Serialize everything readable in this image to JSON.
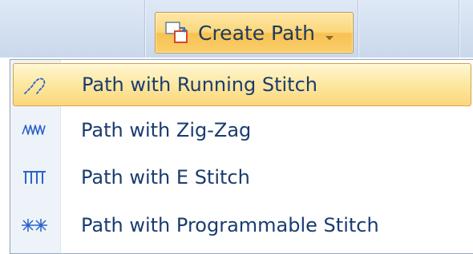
{
  "ribbon": {
    "create_path_button": {
      "label": "Create Path",
      "icon": "create-path-icon"
    }
  },
  "menu": {
    "items": [
      {
        "label": "Path with Running Stitch",
        "icon": "running-stitch-icon",
        "highlighted": true
      },
      {
        "label": "Path with Zig-Zag",
        "icon": "zigzag-stitch-icon",
        "highlighted": false
      },
      {
        "label": "Path with E Stitch",
        "icon": "e-stitch-icon",
        "highlighted": false
      },
      {
        "label": "Path with Programmable Stitch",
        "icon": "programmable-stitch-icon",
        "highlighted": false
      }
    ]
  },
  "colors": {
    "ribbon_background": "#d5e1f2",
    "button_highlight": "#f8c153",
    "menu_highlight": "#fde9a4",
    "menu_text": "#1a3c70",
    "icon_blue": "#2a63c9"
  }
}
